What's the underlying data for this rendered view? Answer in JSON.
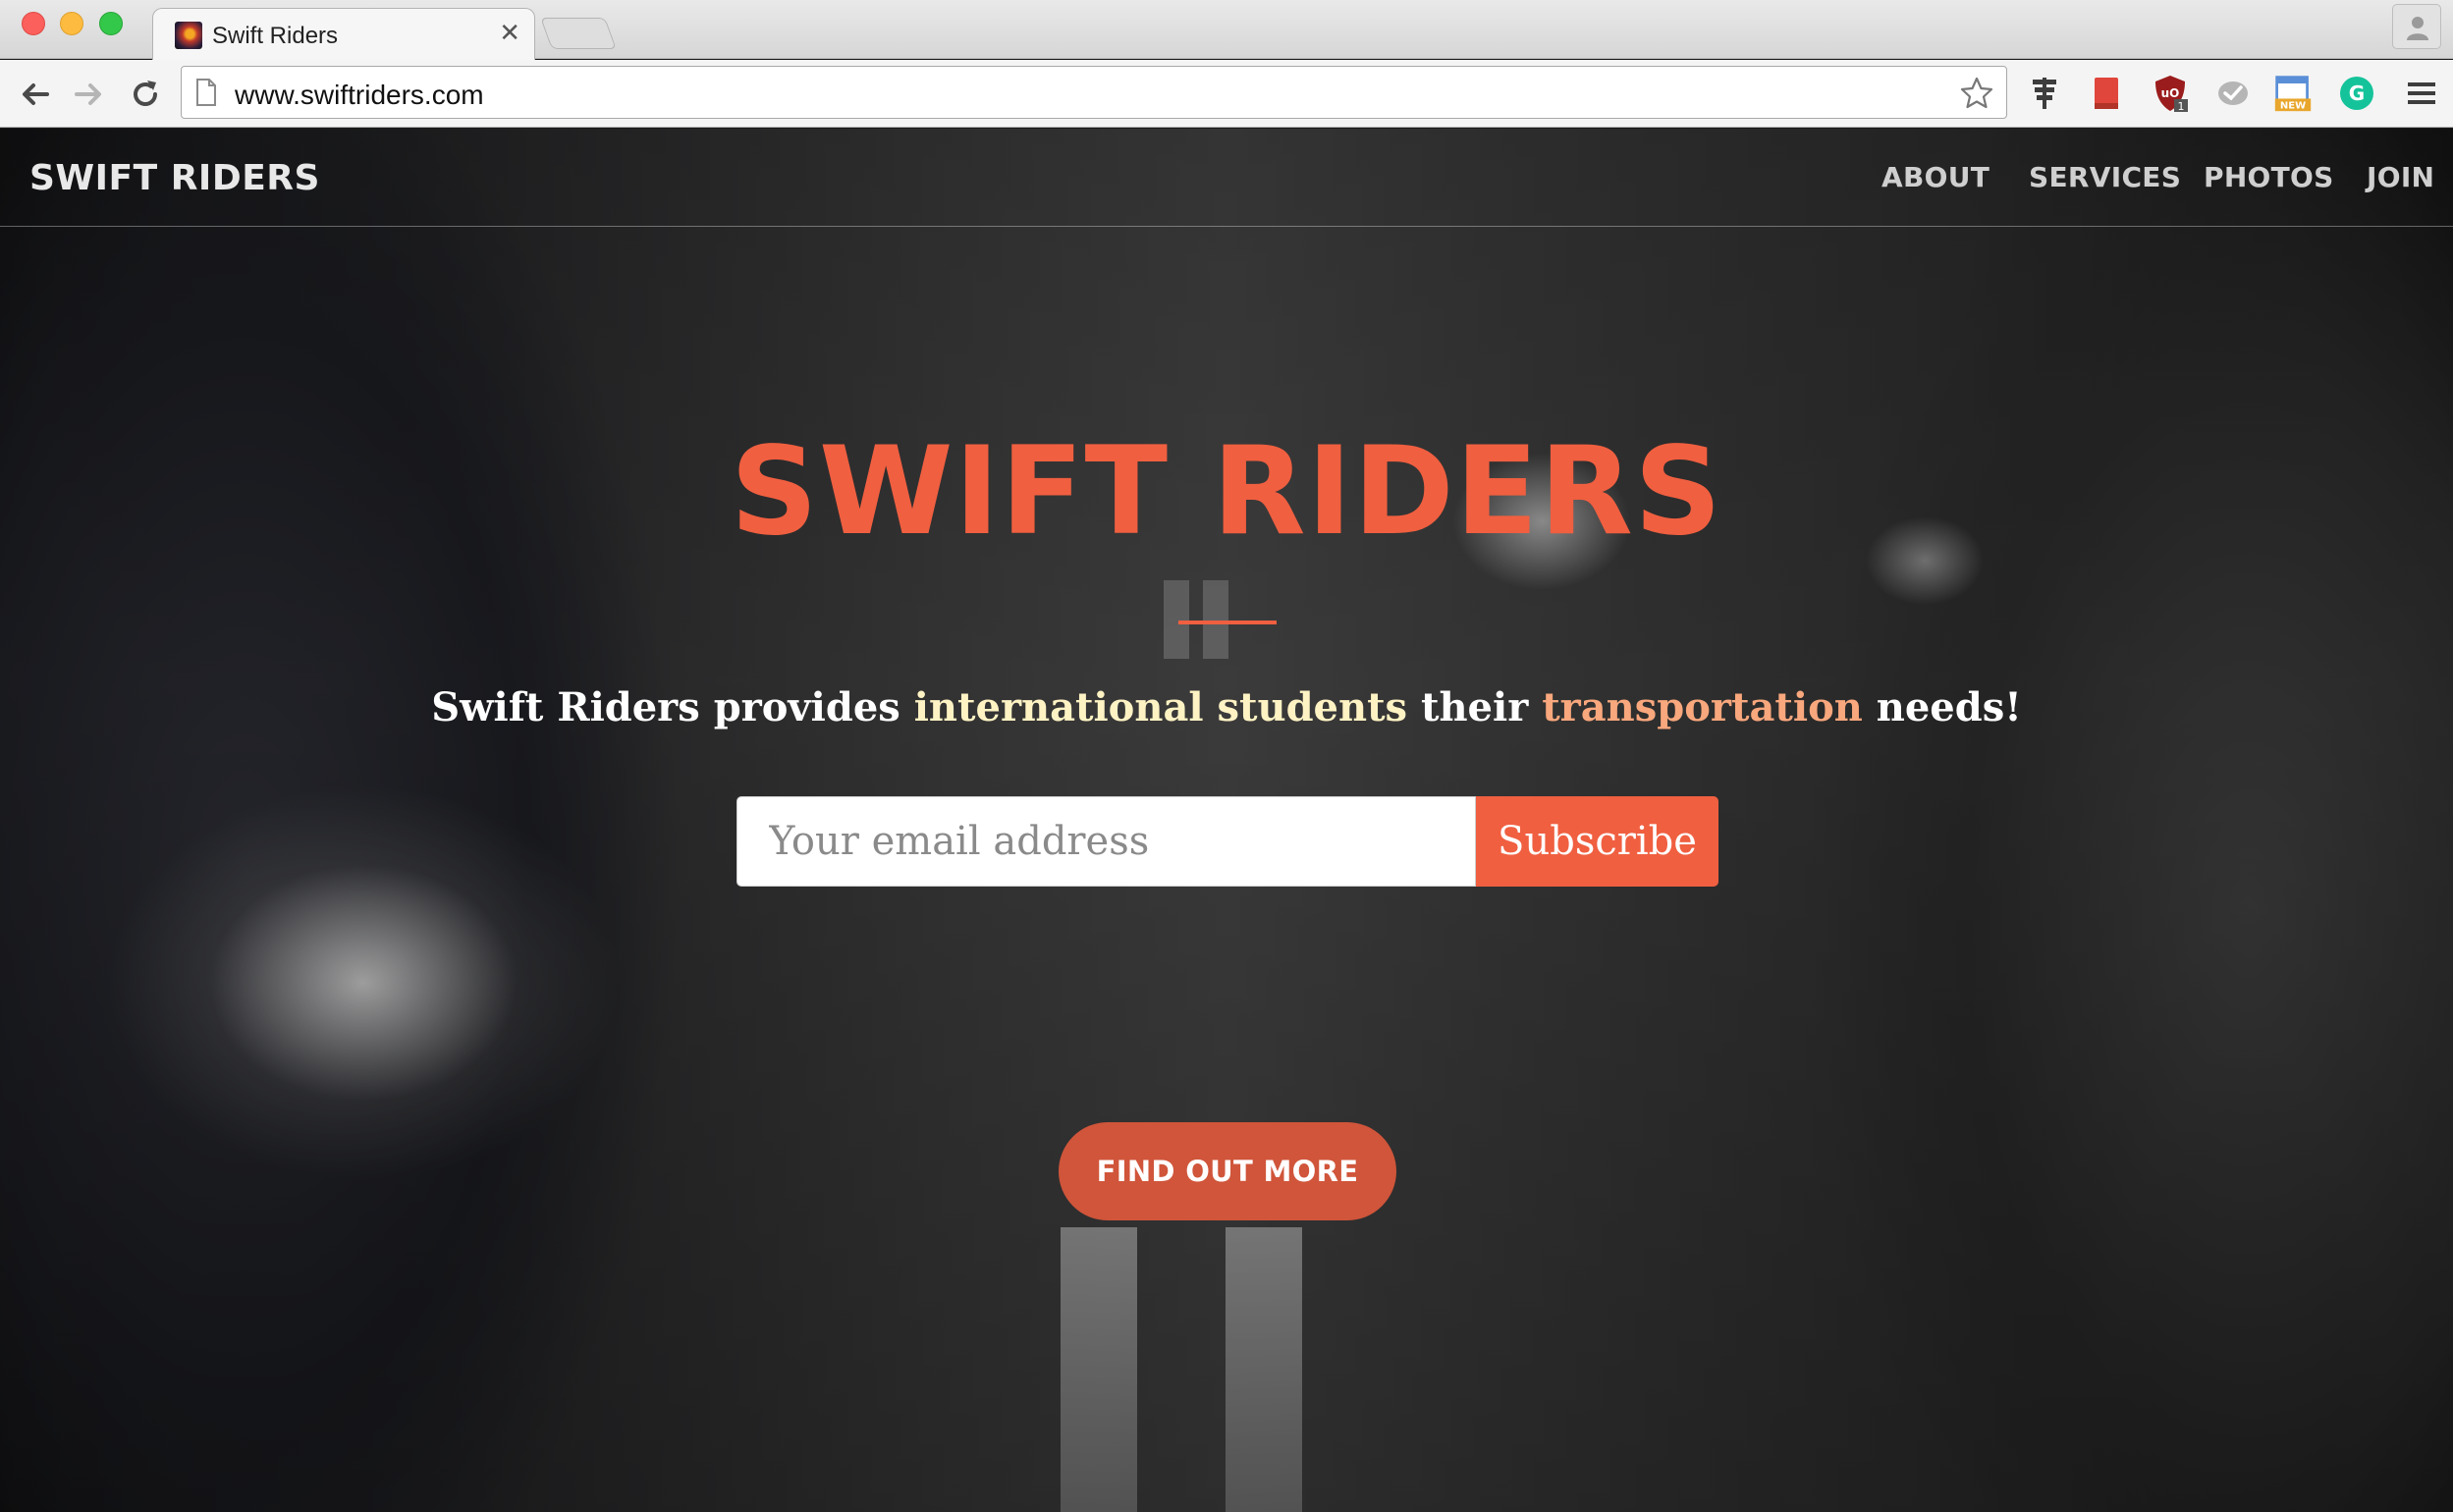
{
  "browser": {
    "tab": {
      "title": "Swift Riders",
      "close_glyph": "✕",
      "favicon": "site-favicon"
    },
    "address_bar": {
      "url": "www.swiftriders.com"
    },
    "extensions": [
      "extension-pin-icon",
      "bookmark-red-icon",
      "ublock-icon",
      "check-circle-icon",
      "new-badge-icon",
      "grammarly-icon"
    ],
    "extension_badges": {
      "ublock": "1",
      "new": "NEW"
    }
  },
  "site": {
    "brand": "SWIFT RIDERS",
    "nav": [
      "ABOUT",
      "SERVICES",
      "PHOTOS",
      "JOIN"
    ],
    "hero": {
      "title": "SWIFT RIDERS",
      "tagline": {
        "part1": "Swift Riders provides ",
        "highlight1": "international students",
        "part2": " their ",
        "highlight2": "transportation",
        "part3": " needs!"
      },
      "email_placeholder": "Your email address",
      "subscribe_label": "Subscribe",
      "cta_label": "FIND OUT MORE"
    }
  },
  "colors": {
    "accent": "#f05f40",
    "highlight_yellow": "#fff3c4",
    "highlight_orange": "#f9a77d"
  }
}
